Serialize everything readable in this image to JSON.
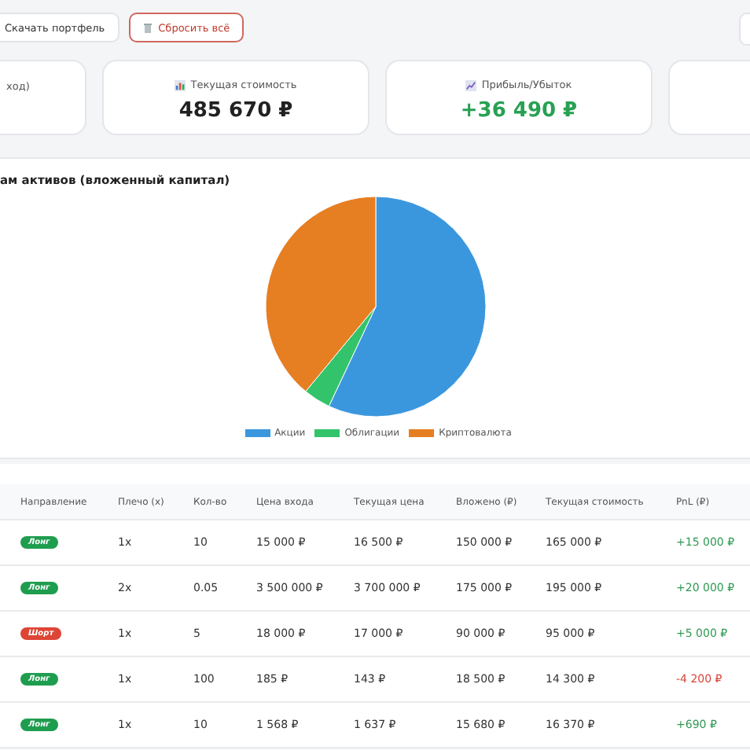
{
  "toolbar": {
    "buttons": [
      {
        "label": "Скачать портфель",
        "kind": "plain"
      },
      {
        "label": "Сбросить всё",
        "kind": "danger"
      }
    ]
  },
  "summary_cards": [
    {
      "label": "ход)"
    },
    {
      "label": "Текущая стоимость",
      "value": "485 670 ₽",
      "kind": "neutral"
    },
    {
      "label": "Прибыль/Убыток",
      "value": "+36 490 ₽",
      "kind": "positive"
    }
  ],
  "allocation": {
    "title": "ам активов (вложенный капитал)",
    "chart_data": {
      "type": "pie",
      "categories": [
        "Акции",
        "Облигации",
        "Криптовалюта"
      ],
      "values": [
        57,
        4,
        39
      ],
      "colors": [
        "#3b97dd",
        "#33c46b",
        "#e67e22"
      ],
      "legend": true
    }
  },
  "positions": {
    "columns": [
      "Направление",
      "Плечо (x)",
      "Кол-во",
      "Цена входа",
      "Текущая цена",
      "Вложено (₽)",
      "Текущая стоимость",
      "PnL (₽)"
    ],
    "rows": [
      {
        "cells": [
          {
            "text": "Лонг",
            "kind": "long"
          },
          {
            "text": "1x",
            "kind": "plain"
          },
          {
            "text": "10",
            "kind": "plain"
          },
          {
            "text": "15 000 ₽",
            "kind": "plain"
          },
          {
            "text": "16 500 ₽",
            "kind": "plain"
          },
          {
            "text": "150 000 ₽",
            "kind": "plain"
          },
          {
            "text": "165 000 ₽",
            "kind": "plain"
          },
          {
            "text": "+15 000 ₽",
            "kind": "profit"
          }
        ]
      },
      {
        "cells": [
          {
            "text": "Лонг",
            "kind": "long"
          },
          {
            "text": "2x",
            "kind": "plain"
          },
          {
            "text": "0.05",
            "kind": "plain"
          },
          {
            "text": "3 500 000 ₽",
            "kind": "plain"
          },
          {
            "text": "3 700 000 ₽",
            "kind": "plain"
          },
          {
            "text": "175 000 ₽",
            "kind": "plain"
          },
          {
            "text": "195 000 ₽",
            "kind": "plain"
          },
          {
            "text": "+20 000 ₽",
            "kind": "profit"
          }
        ]
      },
      {
        "cells": [
          {
            "text": "Шорт",
            "kind": "short"
          },
          {
            "text": "1x",
            "kind": "plain"
          },
          {
            "text": "5",
            "kind": "plain"
          },
          {
            "text": "18 000 ₽",
            "kind": "plain"
          },
          {
            "text": "17 000 ₽",
            "kind": "plain"
          },
          {
            "text": "90 000 ₽",
            "kind": "plain"
          },
          {
            "text": "95 000 ₽",
            "kind": "plain"
          },
          {
            "text": "+5 000 ₽",
            "kind": "profit"
          }
        ]
      },
      {
        "cells": [
          {
            "text": "Лонг",
            "kind": "long"
          },
          {
            "text": "1x",
            "kind": "plain"
          },
          {
            "text": "100",
            "kind": "plain"
          },
          {
            "text": "185 ₽",
            "kind": "plain"
          },
          {
            "text": "143 ₽",
            "kind": "plain"
          },
          {
            "text": "18 500 ₽",
            "kind": "plain"
          },
          {
            "text": "14 300 ₽",
            "kind": "plain"
          },
          {
            "text": "-4 200 ₽",
            "kind": "loss"
          }
        ]
      },
      {
        "cells": [
          {
            "text": "Лонг",
            "kind": "long"
          },
          {
            "text": "1x",
            "kind": "plain"
          },
          {
            "text": "10",
            "kind": "plain"
          },
          {
            "text": "1 568 ₽",
            "kind": "plain"
          },
          {
            "text": "1 637 ₽",
            "kind": "plain"
          },
          {
            "text": "15 680 ₽",
            "kind": "plain"
          },
          {
            "text": "16 370 ₽",
            "kind": "plain"
          },
          {
            "text": "+690 ₽",
            "kind": "profit"
          }
        ]
      }
    ]
  }
}
